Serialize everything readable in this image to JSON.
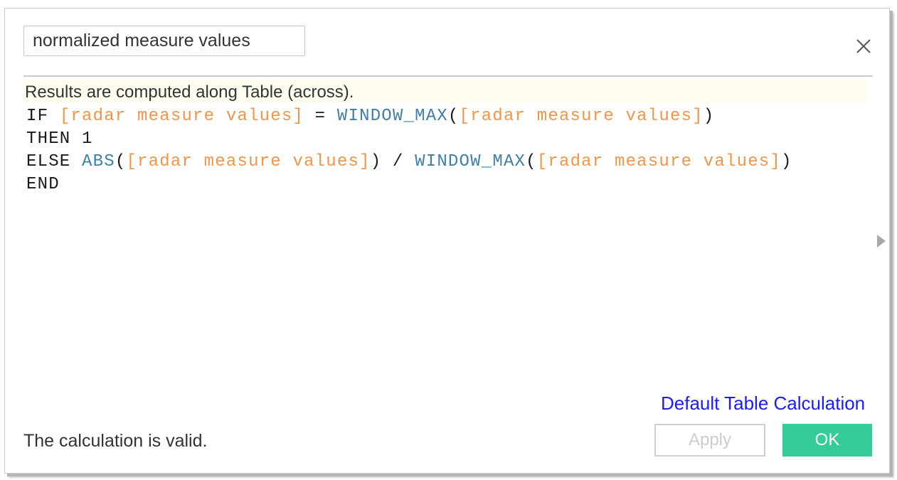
{
  "dialog": {
    "calc_name": "normalized measure values",
    "close_icon": "close-icon",
    "results_note": "Results are computed along Table (across).",
    "formula_lines": [
      [
        {
          "type": "kw",
          "text": "IF "
        },
        {
          "type": "field",
          "text": "[radar measure values]"
        },
        {
          "type": "op",
          "text": " = "
        },
        {
          "type": "fn",
          "text": "WINDOW_MAX"
        },
        {
          "type": "op",
          "text": "("
        },
        {
          "type": "field",
          "text": "[radar measure values]"
        },
        {
          "type": "op",
          "text": ")"
        }
      ],
      [
        {
          "type": "kw",
          "text": "THEN 1"
        }
      ],
      [
        {
          "type": "kw",
          "text": "ELSE "
        },
        {
          "type": "fn",
          "text": "ABS"
        },
        {
          "type": "op",
          "text": "("
        },
        {
          "type": "field",
          "text": "[radar measure values]"
        },
        {
          "type": "op",
          "text": ") / "
        },
        {
          "type": "fn",
          "text": "WINDOW_MAX"
        },
        {
          "type": "op",
          "text": "("
        },
        {
          "type": "field",
          "text": "[radar measure values]"
        },
        {
          "type": "op",
          "text": ")"
        }
      ],
      [
        {
          "type": "kw",
          "text": "END"
        }
      ]
    ],
    "side_panel_icon": "expand-arrow-icon",
    "default_table_calc_link": "Default Table Calculation",
    "status": "The calculation is valid.",
    "buttons": {
      "apply_label": "Apply",
      "ok_label": "OK"
    },
    "colors": {
      "ok_button": "#34cc98",
      "link": "#1a1aff",
      "field_token": "#f0954a",
      "function_token": "#3f7fa8",
      "results_bar": "#fefdf0"
    }
  }
}
